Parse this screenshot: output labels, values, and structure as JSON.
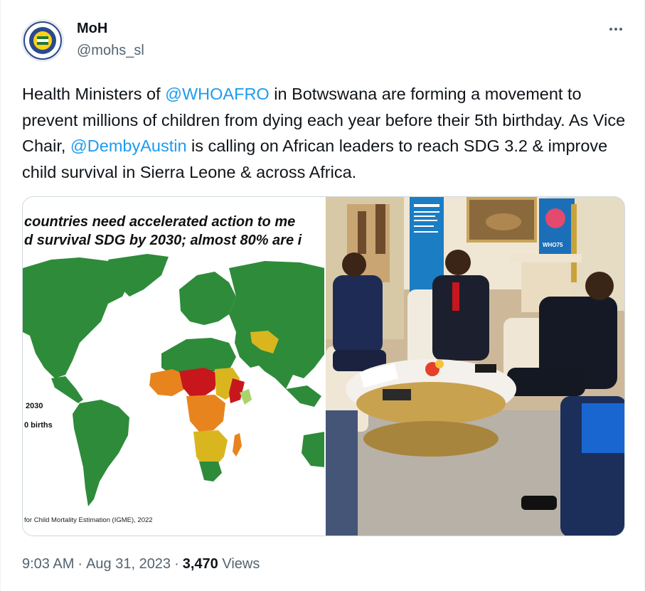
{
  "author": {
    "name": "MoH",
    "handle": "@mohs_sl",
    "avatar_icon": "ministry-seal-icon"
  },
  "tweet": {
    "text_1": "Health Ministers of ",
    "mention_1": "@WHOAFRO",
    "text_2": " in Botwswana are forming a movement to prevent millions of children from dying each year before their 5th birthday. As Vice Chair, ",
    "mention_2": "@DembyAustin",
    "text_3": " is calling on African leaders to reach SDG 3.2 & improve child survival in Sierra Leone & across Africa."
  },
  "media": {
    "map": {
      "title_line1": "countries need accelerated action to me",
      "title_line2": "d survival SDG by 2030; almost 80% are i",
      "legend_year": "2030",
      "legend_unit": "0 births",
      "source": "for Child Mortality Estimation (IGME), 2022"
    },
    "photo": {
      "banner_text": "WHO75"
    }
  },
  "meta": {
    "time": "9:03 AM",
    "date": "Aug 31, 2023",
    "views_count": "3,470",
    "views_label": "Views"
  },
  "colors": {
    "link": "#1d9bf0",
    "secondary_text": "#536471",
    "map_green": "#2e8b3a",
    "map_red": "#c8161d",
    "map_orange": "#e8841d",
    "map_yellow": "#d9b61e"
  }
}
